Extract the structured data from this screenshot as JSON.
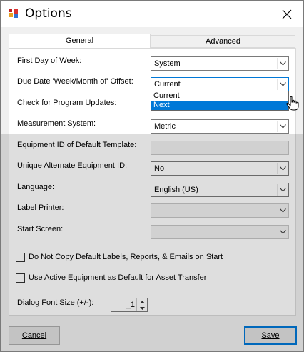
{
  "window": {
    "title": "Options",
    "app_icon": "options-app-icon",
    "close_icon": "close-icon"
  },
  "tabs": [
    {
      "label": "General",
      "selected": true
    },
    {
      "label": "Advanced",
      "selected": false
    }
  ],
  "fields": {
    "first_day": {
      "label": "First Day of Week:",
      "value": "System"
    },
    "due_date": {
      "label": "Due Date 'Week/Month of' Offset:",
      "value": "Current",
      "dropdown_options": [
        "Current",
        "Next"
      ],
      "highlighted": "Next"
    },
    "check_updates": {
      "label": "Check for Program Updates:"
    },
    "measurement": {
      "label": "Measurement System:",
      "value": "Metric"
    },
    "equipment_id": {
      "label": "Equipment ID of Default Template:",
      "value": ""
    },
    "unique_alt": {
      "label": "Unique Alternate Equipment ID:",
      "value": "No"
    },
    "language": {
      "label": "Language:",
      "value": "English (US)"
    },
    "label_printer": {
      "label": "Label Printer:",
      "value": ""
    },
    "start_screen": {
      "label": "Start Screen:",
      "value": ""
    }
  },
  "checkboxes": {
    "no_copy": {
      "label": "Do Not Copy Default Labels, Reports, & Emails on Start",
      "checked": false
    },
    "active_equipment": {
      "label": "Use Active Equipment as Default for Asset Transfer",
      "checked": false
    }
  },
  "font_size": {
    "label": "Dialog Font Size (+/-):",
    "value": "_1"
  },
  "buttons": {
    "cancel": "Cancel",
    "save": "Save"
  },
  "colors": {
    "selection": "#0078d7",
    "default_button_border": "#0078d7"
  }
}
